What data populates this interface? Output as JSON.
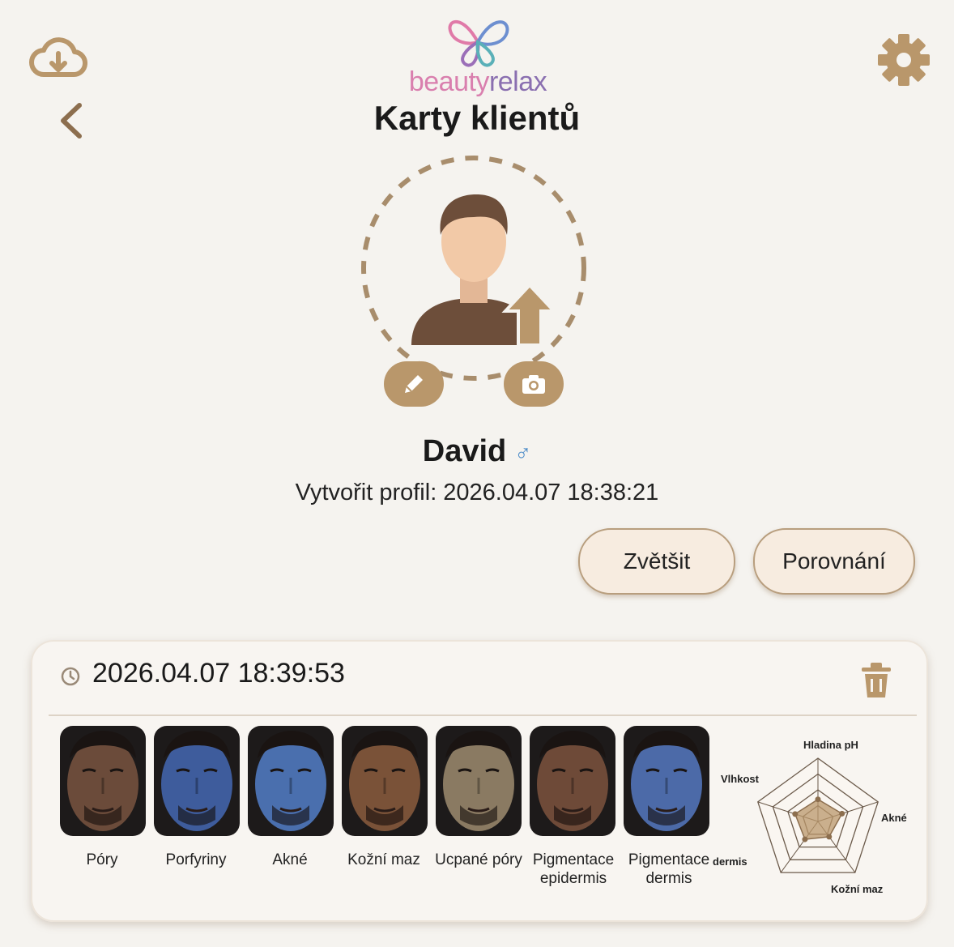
{
  "app": {
    "logo_text_part1": "beauty",
    "logo_text_part2": "relax",
    "title": "Karty klientů"
  },
  "icons": {
    "cloud": "cloud-download-icon",
    "settings": "gear-icon",
    "back": "chevron-left-icon",
    "avatar_upload": "avatar-upload-icon",
    "edit": "pencil-icon",
    "camera": "camera-icon",
    "clock": "clock-icon",
    "delete": "trash-icon"
  },
  "profile": {
    "name": "David",
    "gender_symbol": "♂",
    "created_label": "Vytvořit profil:",
    "created_date": "2026.04.07",
    "created_time": "18:38:21"
  },
  "actions": {
    "zoom_label": "Zvětšit",
    "compare_label": "Porovnání"
  },
  "record": {
    "datetime": "2026.04.07 18:39:53",
    "thumbnails": [
      {
        "label": "Póry",
        "tint": "#6b4b3a"
      },
      {
        "label": "Porfyriny",
        "tint": "#3e5c9c"
      },
      {
        "label": "Akné",
        "tint": "#4a6fae"
      },
      {
        "label": "Kožní maz",
        "tint": "#7a5238"
      },
      {
        "label": "Ucpané póry",
        "tint": "#8a7a62"
      },
      {
        "label": "Pigmentace epidermis",
        "tint": "#6e4a38"
      },
      {
        "label": "Pigmentace dermis",
        "tint": "#4c6aa8"
      }
    ],
    "radar": {
      "labels": {
        "top": "Hladina pH",
        "right": "Akné",
        "bottom_right": "Kožní maz",
        "bottom_left": "dermis",
        "left": "Vlhkost"
      },
      "values": [
        0.35,
        0.4,
        0.3,
        0.35,
        0.38
      ]
    }
  },
  "colors": {
    "accent": "#b9976b",
    "pill_bg": "#f7ece0",
    "background": "#f5f3ef"
  }
}
